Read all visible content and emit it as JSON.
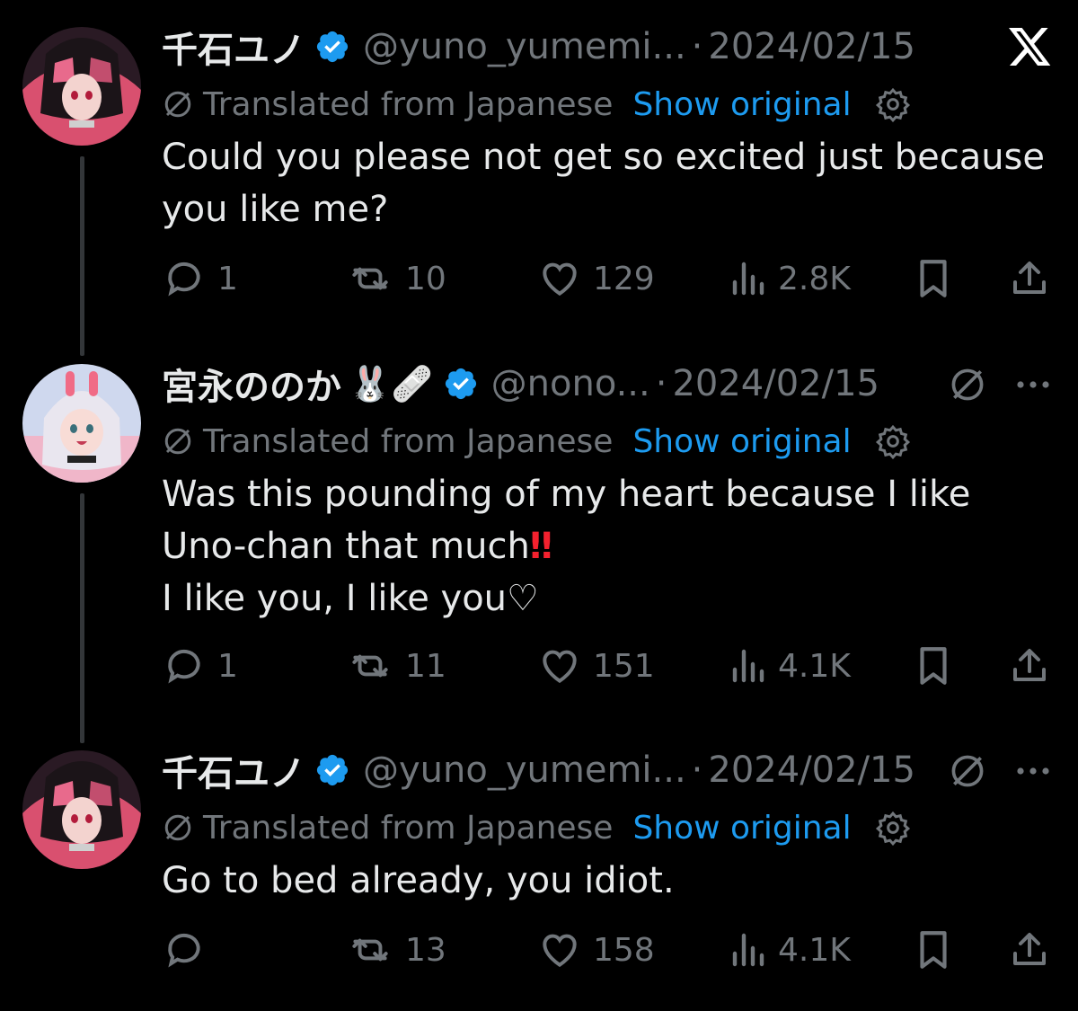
{
  "translation": {
    "label": "Translated from Japanese",
    "show_original": "Show original"
  },
  "colors": {
    "background": "#000000",
    "text": "#e7e9ea",
    "muted": "#71767b",
    "link": "#1d9bf0",
    "verified": "#1d9bf0",
    "emphasis": "#f4212e"
  },
  "tweets": [
    {
      "name": "千石ユノ",
      "handle": "@yuno_yumemi...",
      "sep": "·",
      "date": "2024/02/15",
      "body_lines": [
        "Could you please not get so excited just because",
        "you like me?"
      ],
      "reply_count": "1",
      "retweet_count": "10",
      "like_count": "129",
      "view_count": "2.8K",
      "corner_icon": "x-logo-icon"
    },
    {
      "name": "宮永ののか",
      "emoji": "🐰🩹",
      "handle": "@nono...",
      "sep": "·",
      "date": "2024/02/15",
      "body_line1": "Was this pounding of my heart because I like",
      "body_line2": "Uno-chan that much",
      "body_line2_emph": "‼",
      "body_line3": "I like you, I like you♡",
      "reply_count": "1",
      "retweet_count": "11",
      "like_count": "151",
      "view_count": "4.1K",
      "corner_icon": "more-icon"
    },
    {
      "name": "千石ユノ",
      "handle": "@yuno_yumemi...",
      "sep": "·",
      "date": "2024/02/15",
      "body_lines": [
        "Go to bed already, you idiot."
      ],
      "reply_count": "",
      "retweet_count": "13",
      "like_count": "158",
      "view_count": "4.1K",
      "corner_icon": "more-icon"
    }
  ]
}
